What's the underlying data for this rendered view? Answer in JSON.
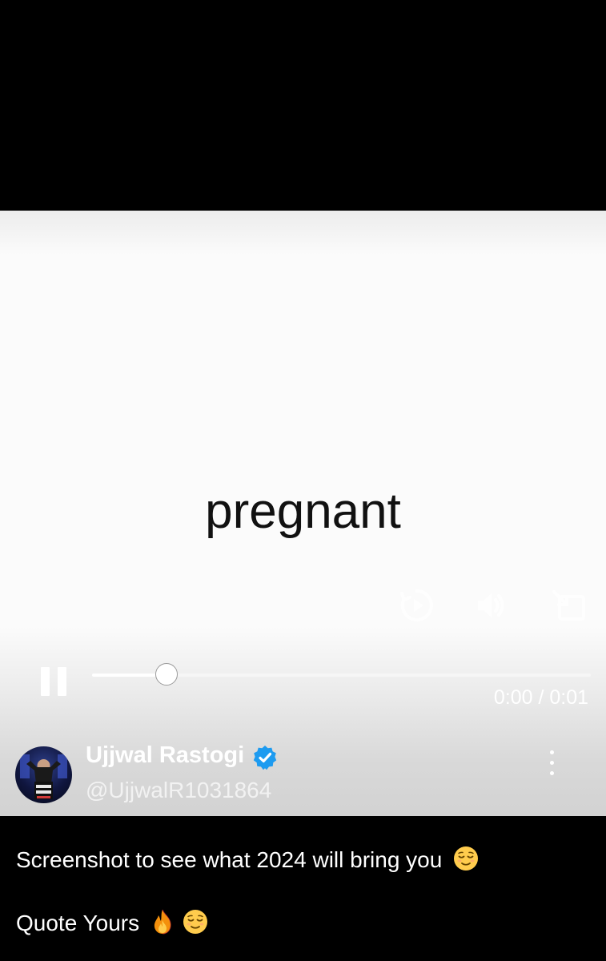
{
  "video": {
    "frame_text": "pregnant",
    "progress": 0.15,
    "time_display": "0:00 / 0:01",
    "controls": {
      "replay_icon": "replay-icon",
      "volume_icon": "volume-icon",
      "cast_icon": "cast-icon",
      "pause_icon": "pause-icon"
    }
  },
  "post": {
    "author_name": "Ujjwal Rastogi",
    "author_handle": "@UjjwalR1031864",
    "verified": true,
    "caption_line1": "Screenshot to see what 2024 will bring you",
    "caption_line2": "Quote Yours",
    "emojis": [
      "relieved-face-emoji",
      "fire-emoji"
    ]
  },
  "colors": {
    "verified_badge": "#1d9bf0",
    "background": "#000000",
    "video_background": "#fbfbfb"
  }
}
